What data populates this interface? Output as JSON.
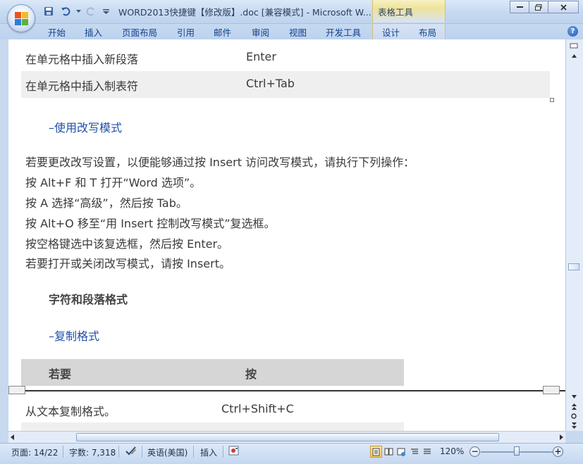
{
  "window": {
    "title": "WORD2013快捷键【修改版】.doc [兼容模式] - Microsoft W...",
    "context_tab_group": "表格工具"
  },
  "ribbon": {
    "tabs": [
      "开始",
      "插入",
      "页面布局",
      "引用",
      "邮件",
      "审阅",
      "视图",
      "开发工具",
      "设计",
      "布局"
    ]
  },
  "document": {
    "top_rows": [
      {
        "action": "在单元格中插入新段落",
        "keys": "Enter"
      },
      {
        "action": "在单元格中插入制表符",
        "keys": "Ctrl+Tab"
      }
    ],
    "heading_overwrite": "使用改写模式",
    "paragraphs": [
      "若要更改改写设置，以便能够通过按 Insert 访问改写模式，请执行下列操作：",
      "按 Alt+F 和 T 打开“Word 选项”。",
      "按 A 选择“高级”，然后按 Tab。",
      "按 Alt+O 移至“用 Insert 控制改写模式”复选框。",
      "按空格键选中该复选框，然后按 Enter。",
      "若要打开或关闭改写模式，请按 Insert。"
    ],
    "section_heading": "字符和段落格式",
    "heading_copy": "复制格式",
    "table_header": {
      "col1": "若要",
      "col2": "按"
    },
    "bottom_rows": [
      {
        "action": "从文本复制格式。",
        "keys": "Ctrl+Shift+C"
      }
    ]
  },
  "statusbar": {
    "page": "页面: 14/22",
    "words": "字数: 7,318",
    "language": "英语(美国)",
    "mode": "插入",
    "zoom": "120%"
  },
  "colors": {
    "link": "#1f4fa8",
    "row_shade": "#efefef",
    "header_shade": "#d6d6d6",
    "chrome": "#c7d9ef"
  }
}
